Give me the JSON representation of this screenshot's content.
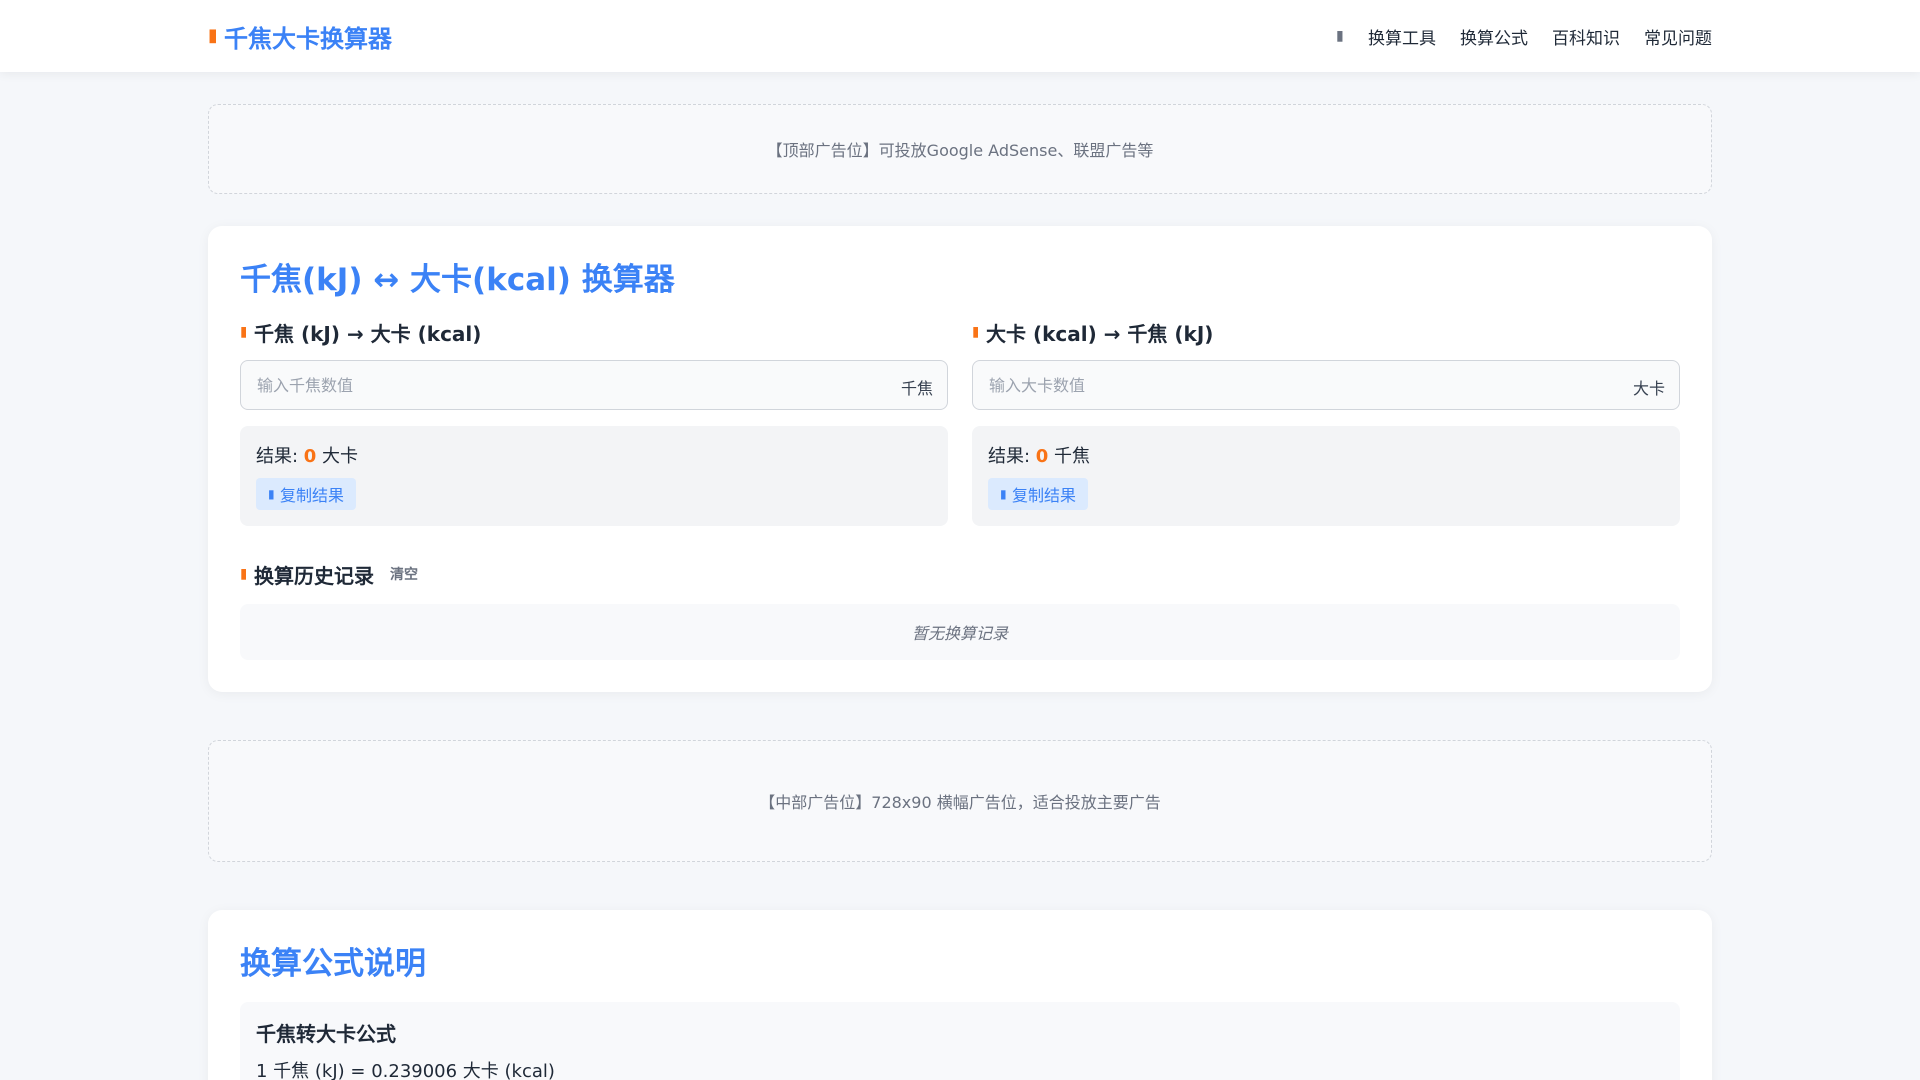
{
  "header": {
    "brand_icon": "calculator-icon",
    "brand": "千焦大卡换算器",
    "nav_icon": "menu-icon",
    "nav": [
      "换算工具",
      "换算公式",
      "百科知识",
      "常见问题"
    ]
  },
  "ads": {
    "top": "【顶部广告位】可投放Google AdSense、联盟广告等",
    "middle": "【中部广告位】728x90 横幅广告位，适合投放主要广告"
  },
  "converter": {
    "title": "千焦(kJ) ↔ 大卡(kcal) 换算器",
    "kj_to_kcal": {
      "heading": "千焦 (kJ) → 大卡 (kcal)",
      "placeholder": "输入千焦数值",
      "value": "",
      "unit": "千焦",
      "result_label": "结果: ",
      "result_value": "0",
      "result_unit": " 大卡",
      "copy_label": "复制结果"
    },
    "kcal_to_kj": {
      "heading": "大卡 (kcal) → 千焦 (kJ)",
      "placeholder": "输入大卡数值",
      "value": "",
      "unit": "大卡",
      "result_label": "结果: ",
      "result_value": "0",
      "result_unit": " 千焦",
      "copy_label": "复制结果"
    },
    "history": {
      "title": "换算历史记录",
      "clear_label": "清空",
      "empty_text": "暂无换算记录"
    }
  },
  "formula": {
    "title": "换算公式说明",
    "kj_to_kcal_title": "千焦转大卡公式",
    "kj_to_kcal_line": "1 千焦 (kJ) = 0.239006 大卡 (kcal)"
  },
  "colors": {
    "accent": "#3b82f6",
    "highlight": "#f97316",
    "background": "#f5f7fa"
  }
}
